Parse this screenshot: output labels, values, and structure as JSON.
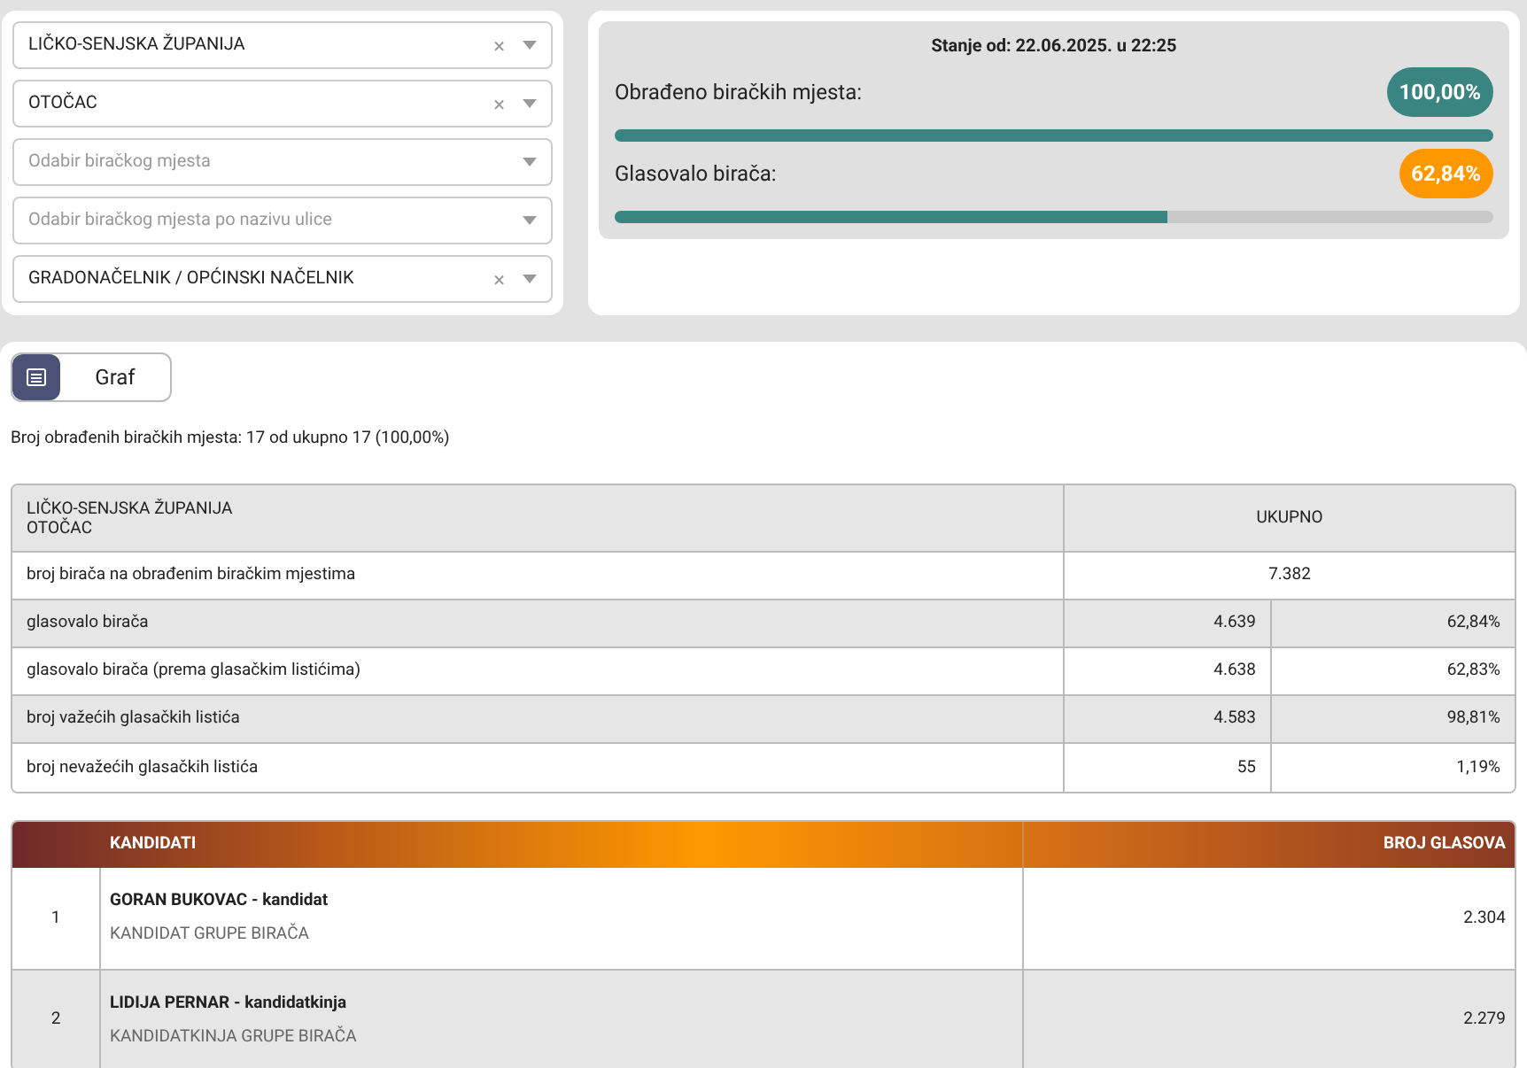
{
  "filters": [
    {
      "value": "LIČKO-SENJSKA ŽUPANIJA",
      "clear": "×"
    },
    {
      "value": "OTOČAC",
      "clear": "×"
    },
    {
      "placeholder": "Odabir biračkog mjesta"
    },
    {
      "placeholder": "Odabir biračkog mjesta po nazivu ulice"
    },
    {
      "value": "GRADONAČELNIK / OPĆINSKI NAČELNIK",
      "clear": "×"
    }
  ],
  "status": {
    "title": "Stanje od: 22.06.2025. u 22:25",
    "meters": [
      {
        "label": "Obrađeno biračkih mjesta:",
        "badge": "100,00%",
        "color": "#3a8582",
        "level": 1
      },
      {
        "label": "Glasovalo birača:",
        "badge": "62,84%",
        "color": "#ff9800",
        "level": 0.6284
      }
    ]
  },
  "view_toggle": {
    "label": "Graf"
  },
  "summary": "Broj obrađenih biračkih mjesta: 17 od ukupno 17 (100,00%)",
  "stats_table": {
    "header_lines": [
      "LIČKO-SENJSKA ŽUPANIJA",
      "OTOČAC"
    ],
    "total_header": "UKUPNO",
    "rows": [
      {
        "label": "broj birača na obrađenim biračkim mjestima",
        "count": "7.382"
      },
      {
        "label": "glasovalo birača",
        "count": "4.639",
        "percent": "62,84%"
      },
      {
        "label": "glasovalo birača (prema glasačkim listićima)",
        "count": "4.638",
        "percent": "62,83%"
      },
      {
        "label": "broj važećih glasačkih listića",
        "count": "4.583",
        "percent": "98,81%"
      },
      {
        "label": "broj nevažećih glasačkih listića",
        "count": "55",
        "percent": "1,19%"
      }
    ]
  },
  "candidates_table": {
    "columns": [
      "KANDIDATI",
      "BROJ GLASOVA"
    ],
    "rows": [
      {
        "number": "1",
        "name": "GORAN BUKOVAC - kandidat",
        "group": "KANDIDAT GRUPE BIRAČA",
        "votes": "2.304"
      },
      {
        "number": "2",
        "name": "LIDIJA PERNAR - kandidatkinja",
        "group": "KANDIDATKINJA GRUPE BIRAČA",
        "votes": "2.279"
      }
    ]
  }
}
